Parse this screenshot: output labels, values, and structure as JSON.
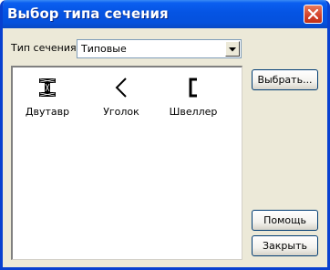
{
  "window": {
    "title": "Выбор типа сечения"
  },
  "form": {
    "type_label": "Тип сечения:",
    "type_selected": "Типовые"
  },
  "list": {
    "items": [
      {
        "label": "Двутавр",
        "icon": "i-beam-icon"
      },
      {
        "label": "Уголок",
        "icon": "angle-icon"
      },
      {
        "label": "Швеллер",
        "icon": "channel-icon"
      }
    ]
  },
  "buttons": {
    "select": "Выбрать...",
    "help": "Помощь",
    "close": "Закрыть"
  }
}
